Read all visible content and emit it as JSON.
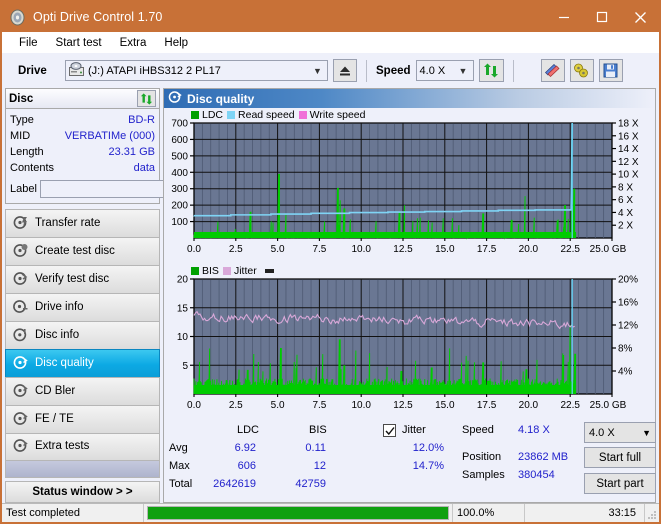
{
  "window": {
    "title": "Opti Drive Control 1.70",
    "icon": "disc-icon",
    "minimize": "minimize",
    "maximize": "maximize",
    "close": "close"
  },
  "menu": {
    "items": [
      "File",
      "Start test",
      "Extra",
      "Help"
    ]
  },
  "toolbar": {
    "drive_label": "Drive",
    "drive_value": "(J:)   ATAPI iHBS312  2 PL17",
    "eject_icon": "eject-icon",
    "speed_label": "Speed",
    "speed_value": "4.0 X",
    "refresh_icon": "refresh-icon",
    "eraser_icon": "eraser-icon",
    "bitsetting_icon": "bitsetting-icon",
    "save_icon": "save-icon"
  },
  "disc_panel": {
    "title": "Disc",
    "refresh_icon": "refresh-icon",
    "rows": [
      {
        "key": "Type",
        "value": "BD-R"
      },
      {
        "key": "MID",
        "value": "VERBATIMe (000)"
      },
      {
        "key": "Length",
        "value": "23.31 GB"
      },
      {
        "key": "Contents",
        "value": "data"
      }
    ],
    "label_key": "Label",
    "label_value": "",
    "label_placeholder": "",
    "label_button_icon": "disc-label-icon"
  },
  "sidebar": {
    "items": [
      {
        "label": "Transfer rate",
        "icon": "disc-test-icon",
        "active": false
      },
      {
        "label": "Create test disc",
        "icon": "disc-create-icon",
        "active": false
      },
      {
        "label": "Verify test disc",
        "icon": "disc-verify-icon",
        "active": false
      },
      {
        "label": "Drive info",
        "icon": "drive-info-icon",
        "active": false
      },
      {
        "label": "Disc info",
        "icon": "disc-info-icon",
        "active": false
      },
      {
        "label": "Disc quality",
        "icon": "disc-quality-icon",
        "active": true
      },
      {
        "label": "CD Bler",
        "icon": "cd-bler-icon",
        "active": false
      },
      {
        "label": "FE / TE",
        "icon": "fe-te-icon",
        "active": false
      },
      {
        "label": "Extra tests",
        "icon": "extra-tests-icon",
        "active": false
      }
    ],
    "status_window": "Status window > >"
  },
  "main": {
    "title": "Disc quality",
    "icon": "disc-quality-icon"
  },
  "stats": {
    "col_ldc": "LDC",
    "col_bis": "BIS",
    "jitter_label": "Jitter",
    "jitter_checked": true,
    "row_avg": "Avg",
    "row_max": "Max",
    "row_total": "Total",
    "avg_ldc": "6.92",
    "avg_bis": "0.11",
    "avg_jitter": "12.0%",
    "max_ldc": "606",
    "max_bis": "12",
    "max_jitter": "14.7%",
    "total_ldc": "2642619",
    "total_bis": "42759",
    "speed_label": "Speed",
    "speed_value": "4.18 X",
    "position_label": "Position",
    "position_value": "23862 MB",
    "samples_label": "Samples",
    "samples_value": "380454",
    "speed_select": "4.0 X",
    "start_full": "Start full",
    "start_part": "Start part"
  },
  "statusbar": {
    "message": "Test completed",
    "progress_pct": 100.0,
    "progress_text": "100.0%",
    "elapsed": "33:15"
  },
  "colors": {
    "title_bar": "#c87137",
    "ldc": "#00a000",
    "bis": "#00cc00",
    "read_speed": "#7fd4f5",
    "write_speed": "#f070d8",
    "jitter": "#d9a8d9",
    "plot_bg": "#6a7793",
    "accent": "#0ca9e4",
    "value_text": "#2222cc"
  },
  "chart_data": [
    {
      "type": "area",
      "name": "disc-quality-ldc-chart",
      "title": "",
      "xlabel": "GB",
      "x": [
        0,
        25.0
      ],
      "xticks": [
        "0.0",
        "2.5",
        "5.0",
        "7.5",
        "10.0",
        "12.5",
        "15.0",
        "17.5",
        "20.0",
        "22.5",
        "25.0 GB"
      ],
      "xlim": [
        0,
        25.0
      ],
      "ylabel_left": "LDC",
      "yticks_left": [
        "100",
        "200",
        "300",
        "400",
        "500",
        "600",
        "700"
      ],
      "ylim_left": [
        0,
        700
      ],
      "ylabel_right": "Speed",
      "yticks_right": [
        "2 X",
        "4 X",
        "6 X",
        "8 X",
        "10 X",
        "12 X",
        "14 X",
        "16 X",
        "18 X"
      ],
      "ylim_right": [
        0,
        18
      ],
      "grid": true,
      "legend": [
        {
          "label": "LDC",
          "color": "#00a000"
        },
        {
          "label": "Read speed",
          "color": "#7fd4f5"
        },
        {
          "label": "Write speed",
          "color": "#f070d8"
        }
      ],
      "series": [
        {
          "name": "LDC",
          "color": "#00cc00",
          "avg": 6.92,
          "max": 606,
          "total": 2642619
        },
        {
          "name": "Read speed",
          "color": "#7fd4f5",
          "start_x": 0.0,
          "start_y": 3.5,
          "end_x": 22.8,
          "end_y": 4.4
        }
      ],
      "ldc_peaks": [
        {
          "x": 3.4,
          "y": 160
        },
        {
          "x": 5.1,
          "y": 390
        },
        {
          "x": 5.5,
          "y": 150
        },
        {
          "x": 8.6,
          "y": 305
        },
        {
          "x": 8.75,
          "y": 230
        },
        {
          "x": 9.0,
          "y": 180
        },
        {
          "x": 12.3,
          "y": 155
        },
        {
          "x": 12.6,
          "y": 200
        },
        {
          "x": 14.9,
          "y": 120
        },
        {
          "x": 17.3,
          "y": 150
        },
        {
          "x": 19.0,
          "y": 110
        },
        {
          "x": 19.8,
          "y": 255
        },
        {
          "x": 22.2,
          "y": 200
        },
        {
          "x": 22.6,
          "y": 606
        },
        {
          "x": 22.75,
          "y": 300
        }
      ]
    },
    {
      "type": "area",
      "name": "disc-quality-bis-jitter-chart",
      "title": "",
      "xlabel": "GB",
      "xticks": [
        "0.0",
        "2.5",
        "5.0",
        "7.5",
        "10.0",
        "12.5",
        "15.0",
        "17.5",
        "20.0",
        "22.5",
        "25.0 GB"
      ],
      "xlim": [
        0,
        25.0
      ],
      "ylabel_left": "BIS",
      "yticks_left": [
        "5",
        "10",
        "15",
        "20"
      ],
      "ylim_left": [
        0,
        20
      ],
      "ylabel_right": "Jitter",
      "yticks_right": [
        "4%",
        "8%",
        "12%",
        "16%",
        "20%"
      ],
      "ylim_right": [
        0,
        20
      ],
      "grid": true,
      "legend": [
        {
          "label": "BIS",
          "color": "#00a000"
        },
        {
          "label": "Jitter",
          "color": "#d9a8d9"
        }
      ],
      "series": [
        {
          "name": "BIS",
          "color": "#00cc00",
          "avg": 0.11,
          "max": 12,
          "total": 42759
        },
        {
          "name": "Jitter",
          "color": "#d9a8d9",
          "avg_pct": 12.0,
          "max_pct": 14.7,
          "band": [
            11.0,
            14.5
          ]
        }
      ],
      "bis_peaks": [
        {
          "x": 3.2,
          "y": 4.2
        },
        {
          "x": 5.2,
          "y": 8.0
        },
        {
          "x": 6.1,
          "y": 4.5
        },
        {
          "x": 8.7,
          "y": 9.5
        },
        {
          "x": 9.0,
          "y": 5.0
        },
        {
          "x": 12.4,
          "y": 4.0
        },
        {
          "x": 14.2,
          "y": 4.6
        },
        {
          "x": 17.3,
          "y": 5.5
        },
        {
          "x": 19.9,
          "y": 4.3
        },
        {
          "x": 22.5,
          "y": 12.0
        },
        {
          "x": 22.8,
          "y": 7.0
        }
      ]
    }
  ]
}
